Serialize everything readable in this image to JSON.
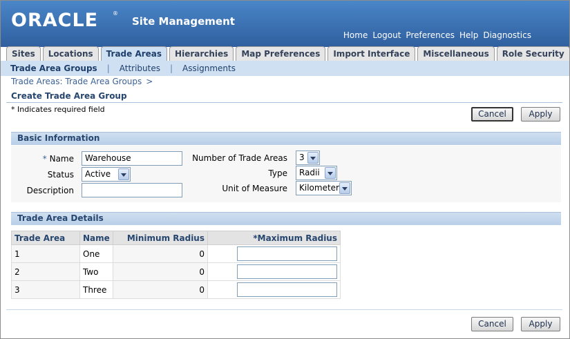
{
  "header": {
    "logo": "ORACLE",
    "logo_reg": "®",
    "app_title": "Site Management",
    "global_links": [
      "Home",
      "Logout",
      "Preferences",
      "Help",
      "Diagnostics"
    ]
  },
  "tabs": {
    "sites": "Sites",
    "locations": "Locations",
    "trade_areas": "Trade Areas",
    "hierarchies": "Hierarchies",
    "map_preferences": "Map Preferences",
    "import_interface": "Import Interface",
    "miscellaneous": "Miscellaneous",
    "role_security": "Role Security"
  },
  "subtabs": {
    "trade_area_groups": "Trade Area Groups",
    "attributes": "Attributes",
    "assignments": "Assignments",
    "separator": "|"
  },
  "breadcrumb": {
    "text": "Trade Areas: Trade Area Groups",
    "arrow": ">"
  },
  "page": {
    "title": "Create Trade Area Group",
    "required_note": "* Indicates required field",
    "cancel_label": "Cancel",
    "apply_label": "Apply"
  },
  "basic_info": {
    "section_title": "Basic Information",
    "name_star": "*",
    "name_label": "Name",
    "name_value": "Warehouse",
    "status_label": "Status",
    "status_value": "Active",
    "description_label": "Description",
    "description_value": "",
    "num_trade_areas_label": "Number of Trade Areas",
    "num_trade_areas_value": "3",
    "type_label": "Type",
    "type_value": "Radii",
    "uom_label": "Unit of Measure",
    "uom_value": "Kilometer"
  },
  "details": {
    "section_title": "Trade Area Details",
    "columns": {
      "trade_area": "Trade Area",
      "name": "Name",
      "min_radius": "Minimum Radius",
      "max_star": "*",
      "max_radius": "Maximum Radius"
    },
    "rows": [
      {
        "trade_area": "1",
        "name": "One",
        "min_radius": "0",
        "max_radius": ""
      },
      {
        "trade_area": "2",
        "name": "Two",
        "min_radius": "0",
        "max_radius": ""
      },
      {
        "trade_area": "3",
        "name": "Three",
        "min_radius": "0",
        "max_radius": ""
      }
    ]
  },
  "colors": {
    "header_blue": "#3a6fb3",
    "subtab_band": "#cfe0f2",
    "text_blue": "#26466f"
  }
}
